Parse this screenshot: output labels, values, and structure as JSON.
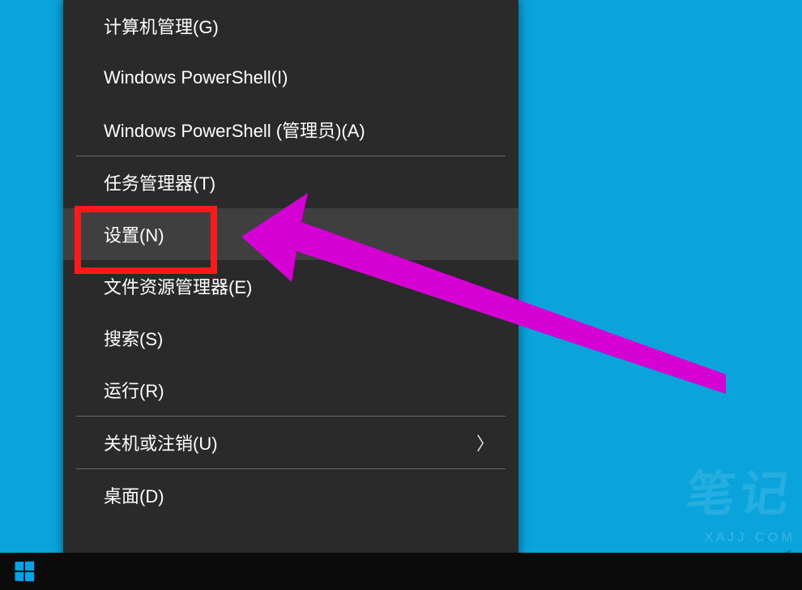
{
  "menu": {
    "items": [
      {
        "label": "计算机管理(G)"
      },
      {
        "label": "Windows PowerShell(I)"
      },
      {
        "label": "Windows PowerShell (管理员)(A)"
      },
      {
        "label": "任务管理器(T)"
      },
      {
        "label": "设置(N)",
        "highlighted": true,
        "hovered": true
      },
      {
        "label": "文件资源管理器(E)"
      },
      {
        "label": "搜索(S)"
      },
      {
        "label": "运行(R)"
      },
      {
        "label": "关机或注销(U)",
        "submenu": true
      },
      {
        "label": "桌面(D)"
      }
    ]
  },
  "watermark": {
    "big": "笔记",
    "small": "X A J J . C O M"
  },
  "annotations": {
    "highlight_color": "#ff1a1a",
    "arrow_color": "#d400d4"
  }
}
